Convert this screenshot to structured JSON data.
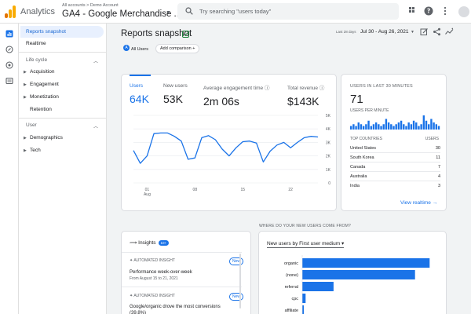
{
  "header": {
    "app_name": "Analytics",
    "breadcrumb": "All accounts > Demo Account",
    "property": "GA4 - Google Merchandise ...",
    "search_placeholder": "Try searching \"users today\""
  },
  "nav": {
    "items": [
      {
        "label": "Reports snapshot",
        "active": true
      },
      {
        "label": "Realtime"
      }
    ],
    "lifecycle_label": "Life cycle",
    "lifecycle": [
      "Acquisition",
      "Engagement",
      "Monetization"
    ],
    "retention": "Retention",
    "user_label": "User",
    "user": [
      "Demographics",
      "Tech"
    ]
  },
  "main": {
    "title": "Reports snapshot",
    "date_label": "Last 28 days",
    "date_range": "Jul 30 - Aug 26, 2021",
    "filter_chip": "All Users",
    "add_comparison": "Add comparison"
  },
  "kpis": [
    {
      "label": "Users",
      "value": "64K",
      "active": true
    },
    {
      "label": "New users",
      "value": "53K"
    },
    {
      "label": "Average engagement time",
      "value": "2m 06s"
    },
    {
      "label": "Total revenue",
      "value": "$143K"
    }
  ],
  "chart_data": [
    {
      "type": "line",
      "x": [
        "Jul 30",
        "Jul 31",
        "Aug 1",
        "Aug 2",
        "Aug 3",
        "Aug 4",
        "Aug 5",
        "Aug 6",
        "Aug 7",
        "Aug 8",
        "Aug 9",
        "Aug 10",
        "Aug 11",
        "Aug 12",
        "Aug 13",
        "Aug 14",
        "Aug 15",
        "Aug 16",
        "Aug 17",
        "Aug 18",
        "Aug 19",
        "Aug 20",
        "Aug 21",
        "Aug 22",
        "Aug 23",
        "Aug 24",
        "Aug 25",
        "Aug 26"
      ],
      "series": [
        {
          "values": [
            2400,
            1450,
            2000,
            3650,
            3700,
            3700,
            3450,
            3100,
            1750,
            1850,
            3350,
            3500,
            3200,
            2500,
            2000,
            2600,
            3050,
            3100,
            2950,
            1550,
            2350,
            2800,
            3000,
            2600,
            3000,
            3350,
            3450,
            3400
          ]
        }
      ],
      "ylim": [
        0,
        5000
      ],
      "y_ticks": [
        "5K",
        "4K",
        "3K",
        "2K",
        "1K",
        "0"
      ],
      "x_tick_labels": [
        {
          "day": "01",
          "month": "Aug"
        },
        {
          "day": "08",
          "month": ""
        },
        {
          "day": "15",
          "month": ""
        },
        {
          "day": "22",
          "month": ""
        }
      ],
      "grid": true
    },
    {
      "type": "bar",
      "title": "New users by First user medium",
      "categories": [
        "organic",
        "(none)",
        "referral",
        "cpc",
        "affiliate"
      ],
      "values": [
        30500,
        27000,
        7500,
        800,
        400
      ],
      "orientation": "horizontal"
    }
  ],
  "realtime": {
    "title": "USERS IN LAST 30 MINUTES",
    "value": "71",
    "per_minute_label": "USERS PER MINUTE",
    "per_minute": [
      2,
      3,
      2,
      4,
      3,
      2,
      3,
      5,
      2,
      3,
      4,
      3,
      2,
      3,
      6,
      4,
      3,
      2,
      3,
      4,
      5,
      3,
      2,
      4,
      3,
      5,
      4,
      2,
      3,
      8,
      5,
      3,
      6,
      4,
      3,
      2
    ],
    "col_country": "TOP COUNTRIES",
    "col_users": "USERS",
    "countries": [
      {
        "name": "United States",
        "users": "30"
      },
      {
        "name": "South Korea",
        "users": "11"
      },
      {
        "name": "Canada",
        "users": "7"
      },
      {
        "name": "Australia",
        "users": "4"
      },
      {
        "name": "India",
        "users": "3"
      }
    ],
    "view_link": "View realtime"
  },
  "insights": {
    "title": "Insights",
    "badge": "10+",
    "items": [
      {
        "kind": "AUTOMATED INSIGHT",
        "badge": "New",
        "title": "Performance week-over-week",
        "date": "From August 15 to 21, 2021"
      },
      {
        "kind": "AUTOMATED INSIGHT",
        "badge": "New",
        "title": "Google/organic drove the most conversions (39.8%)"
      }
    ]
  },
  "sources": {
    "question": "WHERE DO YOUR NEW USERS COME FROM?"
  },
  "colors": {
    "accent": "#1a73e8",
    "bar": "#1a73e8"
  }
}
